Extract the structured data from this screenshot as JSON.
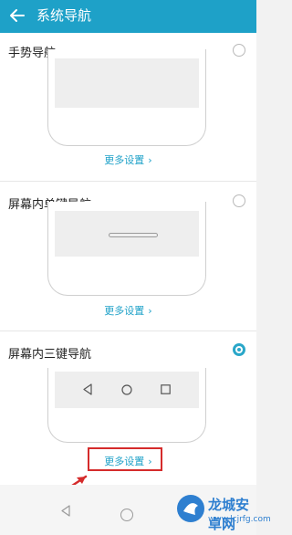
{
  "header": {
    "title": "系统导航"
  },
  "options": [
    {
      "label": "手势导航",
      "more": "更多设置",
      "selected": false
    },
    {
      "label": "屏幕内单键导航",
      "more": "更多设置",
      "selected": false
    },
    {
      "label": "屏幕内三键导航",
      "more": "更多设置",
      "selected": true
    }
  ],
  "colors": {
    "accent": "#1ea1c8",
    "highlight": "#d52b2b"
  },
  "icons": {
    "back": "arrow-left-icon",
    "nav_back": "triangle-back-icon",
    "nav_home": "circle-home-icon",
    "nav_recent": "square-recent-icon",
    "more": "chevron-right-icon"
  },
  "watermark": {
    "name": "龙城安卓网",
    "url": "www.lcjrfg.com"
  }
}
